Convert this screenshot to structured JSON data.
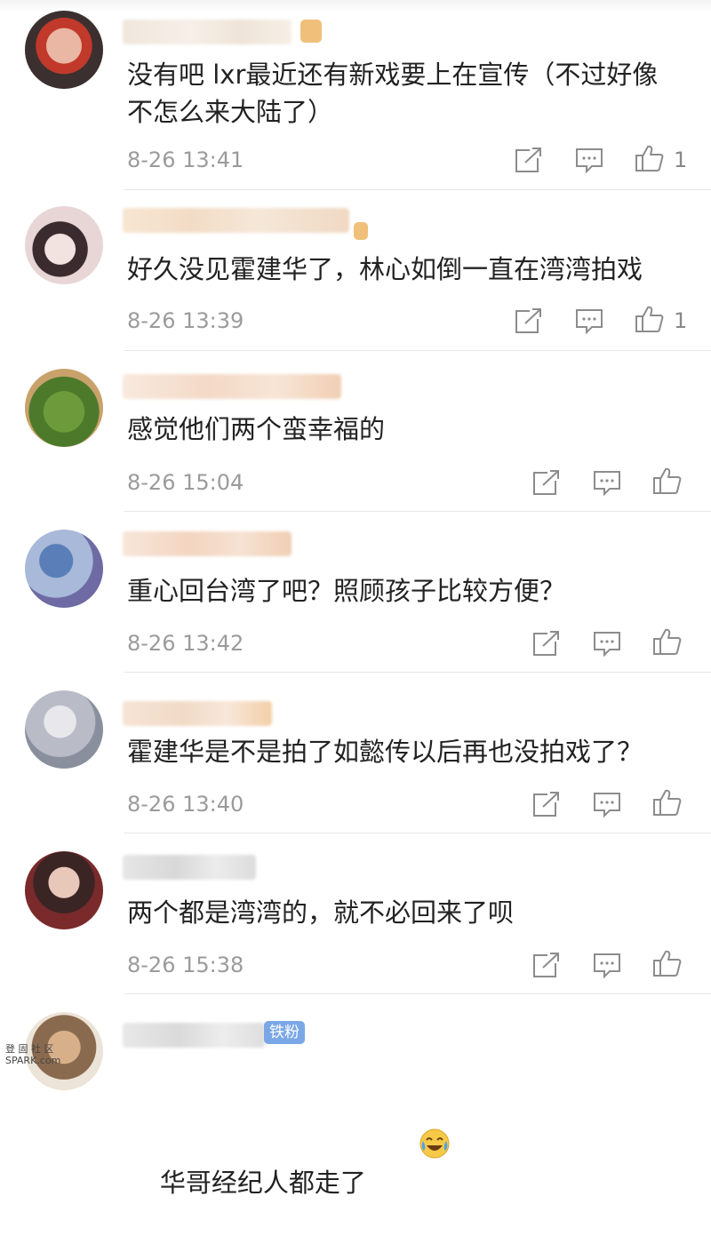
{
  "comments": [
    {
      "text": "没有吧 lxr最近还有新戏要上在宣传（不过好像不怎么来大陆了）",
      "time": "8-26 13:41",
      "likes": "1"
    },
    {
      "text": "好久没见霍建华了，林心如倒一直在湾湾拍戏",
      "time": "8-26 13:39",
      "likes": "1"
    },
    {
      "text": "感觉他们两个蛮幸福的",
      "time": "8-26 15:04",
      "likes": ""
    },
    {
      "text": "重心回台湾了吧？照顾孩子比较方便？",
      "time": "8-26 13:42",
      "likes": ""
    },
    {
      "text": "霍建华是不是拍了如懿传以后再也没拍戏了？",
      "time": "8-26 13:40",
      "likes": ""
    },
    {
      "text": "两个都是湾湾的，就不必回来了呗",
      "time": "8-26 15:38",
      "likes": ""
    },
    {
      "text": "华哥经纪人都走了",
      "time": "",
      "likes": ""
    }
  ],
  "fan_badge": "铁粉",
  "watermark": {
    "line1": "登 固 社 区",
    "line2": "SPARK.com"
  },
  "colors": {
    "icon": "#8c8c8c",
    "time": "#9b9b9b",
    "divider": "#e6e6e6",
    "badge": "#7aa7e6"
  },
  "icons": [
    "share-icon",
    "comment-icon",
    "thumbs-up-icon",
    "crying-laugh-emoji"
  ]
}
